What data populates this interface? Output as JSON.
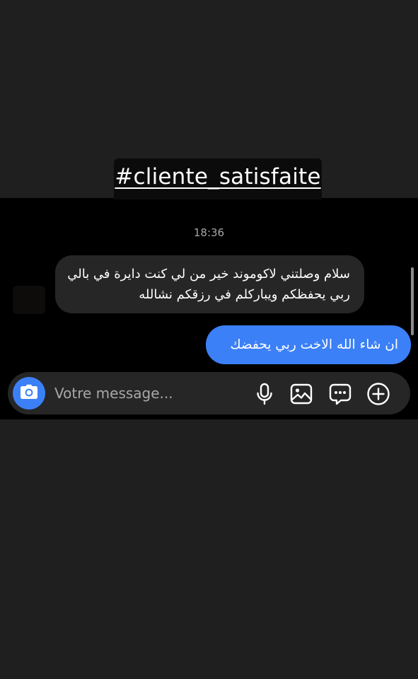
{
  "overlay": {
    "hashtag": "#cliente_satisfaite"
  },
  "chat": {
    "timestamp": "18:36",
    "messages": [
      {
        "direction": "incoming",
        "text": "سلام وصلتني لاكوموند خير من لي كنت دايرة في بالي ربي يحفظكم ويباركلم في رزقكم نشالله"
      },
      {
        "direction": "outgoing",
        "text": "ان شاء الله الاخت ربي يحفضك"
      }
    ]
  },
  "composer": {
    "placeholder": "Votre message...",
    "icons": [
      "camera-icon",
      "microphone-icon",
      "gallery-icon",
      "sticker-icon",
      "plus-icon"
    ]
  },
  "colors": {
    "outgoing_bubble": "#3b80f7",
    "incoming_bubble": "#262626",
    "chat_background": "#000000",
    "page_background": "#1f1f1f"
  }
}
